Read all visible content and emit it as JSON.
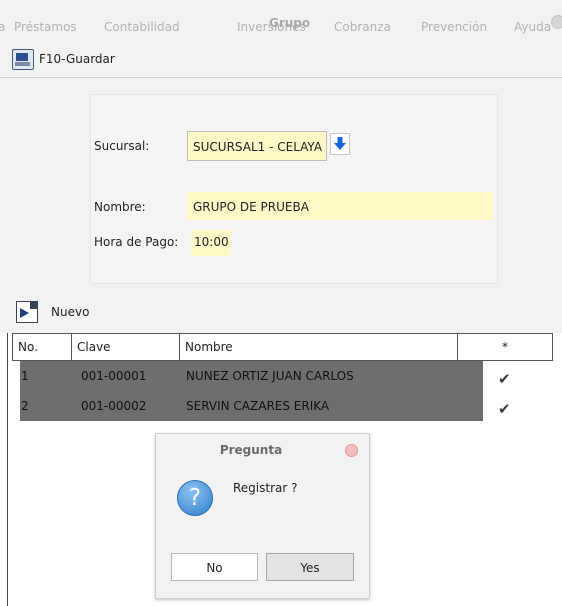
{
  "window": {
    "title": "Grupo"
  },
  "menu": {
    "items": [
      "a",
      "Préstamos",
      "Contabilidad",
      "Inversiones",
      "Cobranza",
      "Prevención",
      "Ayuda"
    ]
  },
  "toolbar": {
    "save_label": "F10-Guardar",
    "save_icon": "save-monitor-icon"
  },
  "form": {
    "sucursal_label": "Sucursal:",
    "sucursal_value": "SUCURSAL1 - CELAYA",
    "nombre_label": "Nombre:",
    "nombre_value": "GRUPO DE PRUEBA",
    "hora_label": "Hora de Pago:",
    "hora_value": "10:00",
    "field_color": "#fdf8c6"
  },
  "nuevo": {
    "label": "Nuevo",
    "icon": "new-document-icon"
  },
  "table": {
    "headers": [
      "No.",
      "Clave",
      "Nombre",
      "*"
    ],
    "rows": [
      {
        "no": "1",
        "clave": "001-00001",
        "nombre": "NUNEZ ORTIZ JUAN CARLOS",
        "mark": "✔"
      },
      {
        "no": "2",
        "clave": "001-00002",
        "nombre": "SERVIN CAZARES ERIKA",
        "mark": "✔"
      }
    ],
    "selected_row_color": "#6e6e6e"
  },
  "dialog": {
    "title": "Pregunta",
    "message": "Registrar ?",
    "icon_glyph": "?",
    "no_label": "No",
    "yes_label": "Yes"
  }
}
